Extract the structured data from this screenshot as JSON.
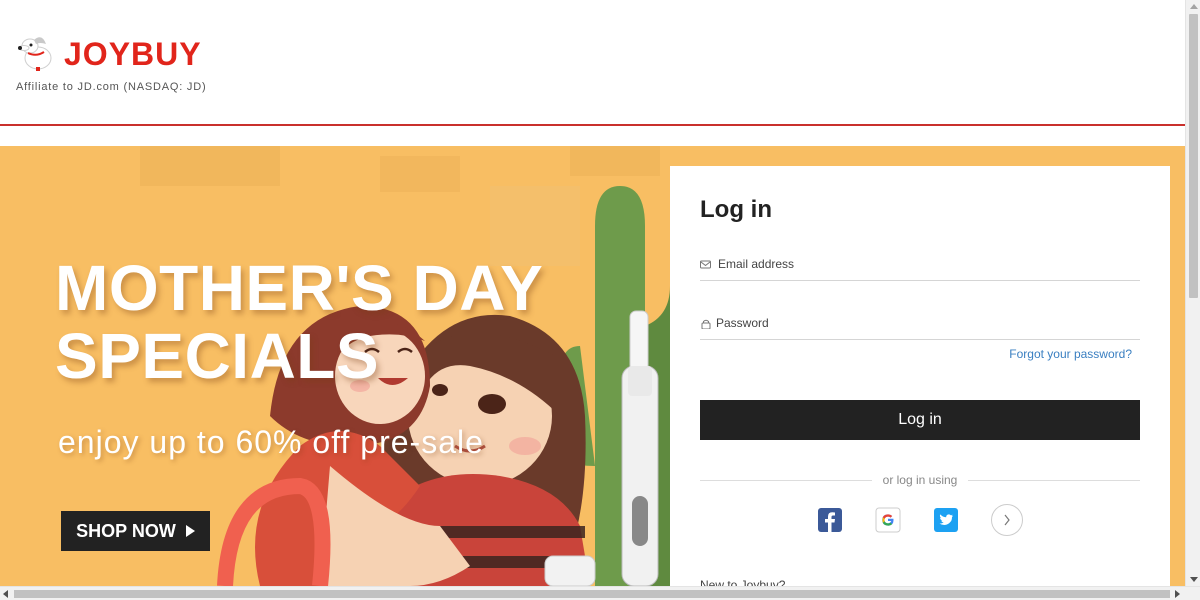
{
  "header": {
    "logo_text": "JOYBUY",
    "logo_subtitle": "Affiliate to JD.com (NASDAQ: JD)"
  },
  "banner": {
    "title_line1": "MOTHER'S DAY",
    "title_line2": "SPECIALS",
    "subtitle": "enjoy up to 60% off pre-sale",
    "cta_label": "SHOP NOW"
  },
  "login": {
    "title": "Log in",
    "email_placeholder": "Email address",
    "email_value": "",
    "password_placeholder": "Password",
    "password_value": "",
    "forgot_label": "Forgot your password?",
    "submit_label": "Log in",
    "divider_label": "or log in using",
    "social": [
      "facebook-icon",
      "google-icon",
      "twitter-icon",
      "chevron-right-icon"
    ],
    "new_to": "New to Joybuy?"
  },
  "colors": {
    "brand_red": "#e1251b",
    "banner_bg": "#f8be63",
    "button_dark": "#222222",
    "link_blue": "#3a7fc1",
    "facebook": "#3b5998",
    "twitter": "#1da1f2"
  }
}
